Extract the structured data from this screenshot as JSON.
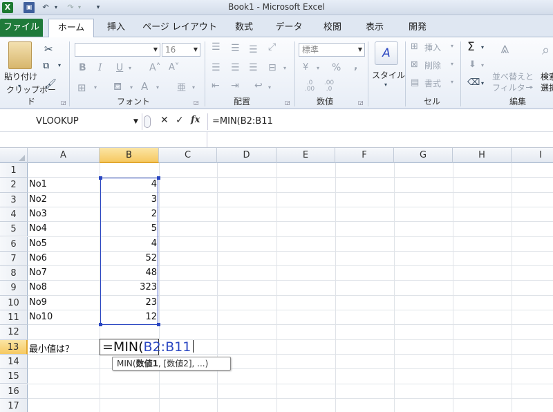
{
  "window": {
    "title": "Book1  -  Microsoft Excel"
  },
  "quick_access": {
    "app_icon": "X",
    "save_icon": "▣",
    "undo_icon": "↶",
    "redo_icon": "↷",
    "dropdown": "▾",
    "customize": "▾"
  },
  "tabs": [
    {
      "label": "ファイル"
    },
    {
      "label": "ホーム"
    },
    {
      "label": "挿入"
    },
    {
      "label": "ページ レイアウト"
    },
    {
      "label": "数式"
    },
    {
      "label": "データ"
    },
    {
      "label": "校閲"
    },
    {
      "label": "表示"
    },
    {
      "label": "開発"
    }
  ],
  "ribbon": {
    "clipboard": {
      "paste_label": "貼り付け",
      "group_label": "クリップボード"
    },
    "font": {
      "font_name": "",
      "font_size": "16",
      "bold": "B",
      "italic": "I",
      "underline": "U",
      "grow": "A˄",
      "shrink": "A˅",
      "group_label": "フォント",
      "color_a": "A",
      "phonetic": "亜"
    },
    "alignment": {
      "group_label": "配置"
    },
    "number": {
      "format": "標準",
      "percent": "%",
      "comma": ",",
      "inc_decimal": ".0 .00",
      "dec_decimal": ".00 .0",
      "group_label": "数値"
    },
    "styles": {
      "label": "スタイル"
    },
    "cells": {
      "insert": "挿入",
      "delete": "削除",
      "format": "書式",
      "group_label": "セル"
    },
    "editing": {
      "sigma": "Σ",
      "sort_label_1": "並べ替えと",
      "sort_label_2": "フィルター",
      "find_label_1": "検索",
      "find_label_2": "選択",
      "group_label": "編集"
    }
  },
  "formula_bar": {
    "name_box": "VLOOKUP",
    "cancel": "✕",
    "enter": "✓",
    "fx": "fx",
    "formula": "=MIN(B2:B11"
  },
  "columns": [
    "A",
    "B",
    "C",
    "D",
    "E",
    "F",
    "G",
    "H",
    "I"
  ],
  "rows": [
    {
      "num": "1",
      "a": "",
      "b": ""
    },
    {
      "num": "2",
      "a": "No1",
      "b": "4"
    },
    {
      "num": "3",
      "a": "No2",
      "b": "3"
    },
    {
      "num": "4",
      "a": "No3",
      "b": "2"
    },
    {
      "num": "5",
      "a": "No4",
      "b": "5"
    },
    {
      "num": "6",
      "a": "No5",
      "b": "4"
    },
    {
      "num": "7",
      "a": "No6",
      "b": "52"
    },
    {
      "num": "8",
      "a": "No7",
      "b": "48"
    },
    {
      "num": "9",
      "a": "No8",
      "b": "323"
    },
    {
      "num": "10",
      "a": "No9",
      "b": "23"
    },
    {
      "num": "11",
      "a": "No10",
      "b": "12"
    },
    {
      "num": "12",
      "a": "",
      "b": ""
    },
    {
      "num": "13",
      "a": "最小値は？",
      "b": ""
    },
    {
      "num": "14",
      "a": "",
      "b": ""
    },
    {
      "num": "15",
      "a": "",
      "b": ""
    },
    {
      "num": "16",
      "a": "",
      "b": ""
    },
    {
      "num": "17",
      "a": "",
      "b": ""
    }
  ],
  "edit": {
    "prefix": "=MIN(",
    "range": "B2:B11"
  },
  "tooltip": {
    "fn": "MIN(",
    "arg1": "数値1",
    "rest": ", [数値2], ...)"
  },
  "selection": {
    "active_column": "B",
    "active_row": "13"
  }
}
